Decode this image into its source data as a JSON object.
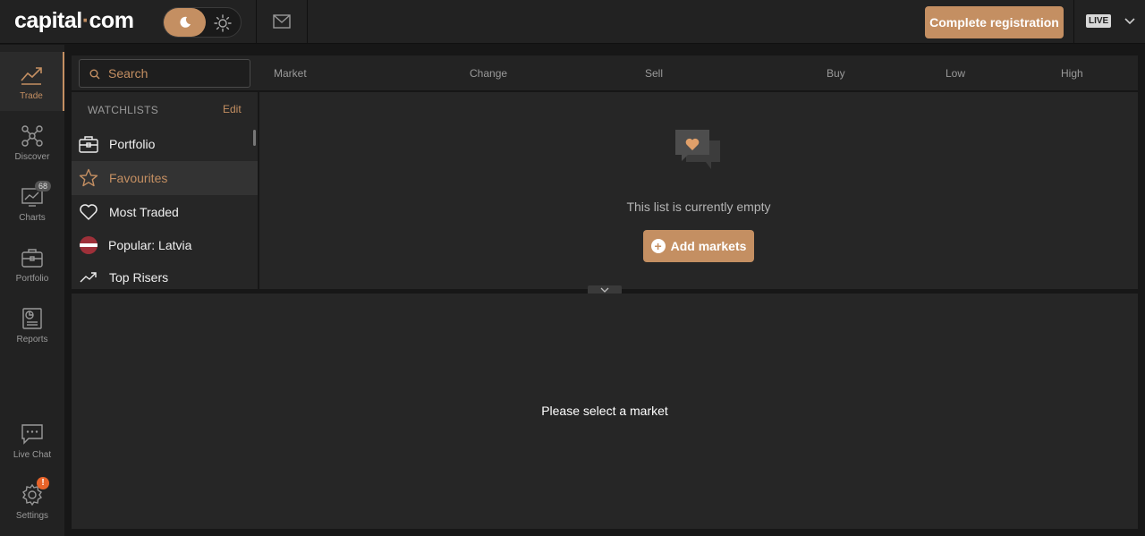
{
  "brand": {
    "logo_left": "capital",
    "logo_dot": "·",
    "logo_right": "com",
    "accent": "#c48f62"
  },
  "header": {
    "register_label": "Complete registration",
    "account_mode": "LIVE",
    "icons": [
      "moon-icon",
      "sun-icon",
      "mail-icon",
      "chevron-down-icon"
    ]
  },
  "sidebar": {
    "items": [
      {
        "label": "Trade",
        "icon": "trend-icon",
        "active": true
      },
      {
        "label": "Discover",
        "icon": "network-icon"
      },
      {
        "label": "Charts",
        "icon": "chart-icon",
        "badge": "68"
      },
      {
        "label": "Portfolio",
        "icon": "briefcase-icon"
      },
      {
        "label": "Reports",
        "icon": "report-icon"
      },
      {
        "label": "Live Chat",
        "icon": "chat-icon"
      },
      {
        "label": "Settings",
        "icon": "gear-icon",
        "badge": "!"
      }
    ]
  },
  "search": {
    "placeholder": "Search"
  },
  "columns": [
    "Market",
    "Change",
    "Sell",
    "Buy",
    "Low",
    "High"
  ],
  "watchlists": {
    "heading": "WATCHLISTS",
    "edit_label": "Edit",
    "items": [
      {
        "label": "Portfolio",
        "icon": "briefcase-icon"
      },
      {
        "label": "Favourites",
        "icon": "star-icon",
        "selected": true
      },
      {
        "label": "Most Traded",
        "icon": "heart-icon"
      },
      {
        "label": "Popular: Latvia",
        "icon": "latvia-flag-icon"
      },
      {
        "label": "Top Risers",
        "icon": "trend-up-icon"
      }
    ]
  },
  "list": {
    "empty_text": "This list is currently empty",
    "add_label": "Add markets"
  },
  "details": {
    "message": "Please select a market"
  }
}
